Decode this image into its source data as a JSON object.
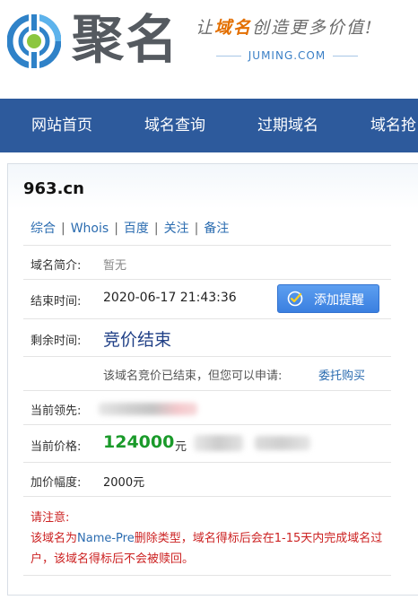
{
  "header": {
    "logo_text": "聚名",
    "slogan_pre": "让",
    "slogan_highlight": "域名",
    "slogan_post": "创造更多价值!",
    "site_domain": "JUMING.COM"
  },
  "nav": {
    "items": [
      "网站首页",
      "域名查询",
      "过期域名",
      "域名抢"
    ]
  },
  "domain": {
    "name": "963.cn",
    "links": [
      "综合",
      "Whois",
      "百度",
      "关注",
      "备注"
    ]
  },
  "info": {
    "intro_label": "域名简介:",
    "intro_value": "暂无",
    "end_label": "结束时间:",
    "end_value": "2020-06-17 21:43:36",
    "remind_button": "添加提醒",
    "remain_label": "剩余时间:",
    "remain_value": "竞价结束",
    "ended_text": "该域名竞价已结束，但您可以申请:",
    "entrust_link": "委托购买",
    "leader_label": "当前领先:",
    "price_label": "当前价格:",
    "price_value": "124000",
    "price_unit": "元",
    "increment_label": "加价幅度:",
    "increment_value": "2000元"
  },
  "notice": {
    "title": "请注意:",
    "line_pre": "该域名为",
    "line_type": "Name-Pre",
    "line_post": "删除类型，域名得标后会在1-15天内完成域名过户，该域名得标后不会被赎回。"
  },
  "colors": {
    "nav_bg": "#2d5a9c",
    "link_blue": "#2b6cb0",
    "price_green": "#1a9a2a",
    "notice_red": "#cc2222",
    "brand_orange": "#e36f00"
  }
}
